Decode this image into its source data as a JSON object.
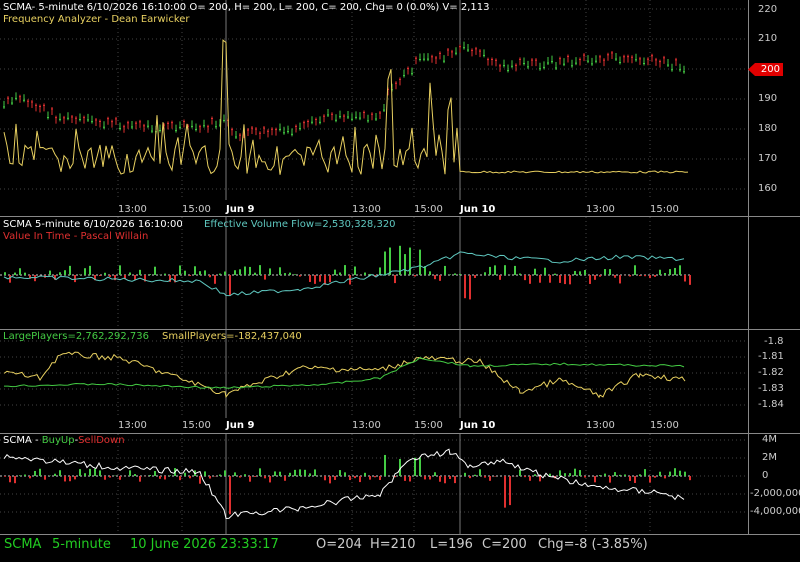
{
  "panel1": {
    "title": "SCMA- 5-minute 6/10/2026 16:10:00 O= 200, H= 200, L= 200, C= 200, Chg= 0 (0.0%) V= 2,113",
    "subtitle": "Frequency Analyzer - Dean Earwicker",
    "price_badge": "200",
    "yticks": [
      "220",
      "210",
      "200",
      "190",
      "180",
      "170",
      "160"
    ],
    "xticks": [
      "13:00",
      "15:00",
      "Jun 9",
      "13:00",
      "15:00",
      "Jun 10",
      "13:00",
      "15:00"
    ]
  },
  "panel2": {
    "title": "SCMA 5-minute  6/10/2026 16:10:00",
    "indicator": "Effective Volume Flow=2,530,328,320",
    "subtitle": "Value In Time - Pascal Willain"
  },
  "panel3": {
    "large_players": "LargePlayers=2,762,292,736",
    "small_players": "SmallPlayers=-182,437,040",
    "yticks": [
      "-1.8",
      "-1.81",
      "-1.82",
      "-1.83",
      "-1.84"
    ],
    "xticks": [
      "13:00",
      "15:00",
      "Jun 9",
      "13:00",
      "15:00",
      "Jun 10",
      "13:00",
      "15:00"
    ]
  },
  "panel4": {
    "title": "SCMA - ",
    "buyup": "BuyUp",
    "dash": "-",
    "selldown": "SellDown",
    "yticks": [
      "4M",
      "2M",
      "0",
      "-2,000,000",
      "-4,000,000"
    ]
  },
  "status": {
    "symbol": "SCMA",
    "interval": "5-minute",
    "datetime": "10 June 2026 23:33:17",
    "open": "O=204",
    "high": "H=210",
    "low": "L=196",
    "close": "C=200",
    "change": "Chg=-8 (-3.85%)"
  },
  "colors": {
    "background": "#000000",
    "grid": "#555555",
    "up_bar": "#44cc44",
    "down_bar": "#e03030",
    "yellow_line": "#e8d060",
    "cyan_line": "#5fc8c0",
    "green_line": "#44cc44",
    "white_line": "#ffffff",
    "status_green": "#22cc22"
  }
}
